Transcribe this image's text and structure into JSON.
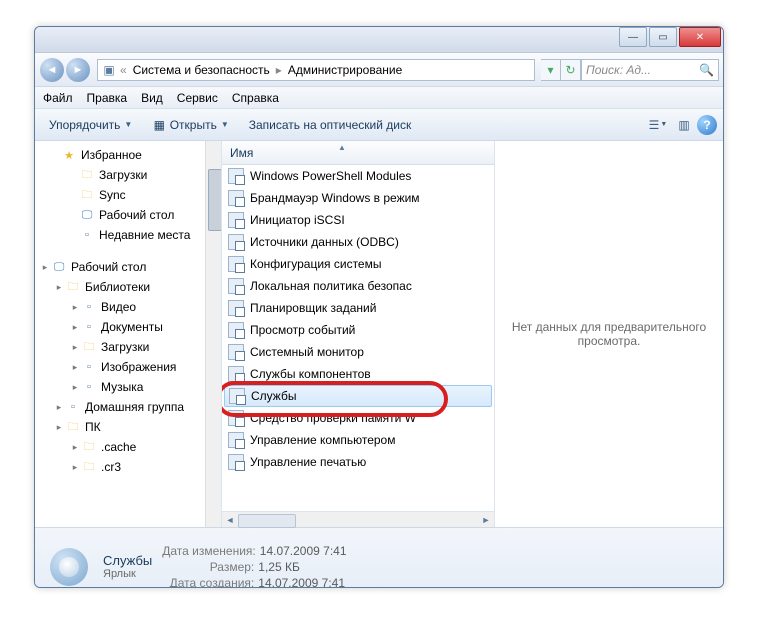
{
  "title": {
    "minimize": "—",
    "maximize": "▭",
    "close": "✕"
  },
  "breadcrumbs": {
    "pre": "«",
    "a": "Система и безопасность",
    "b": "Администрирование"
  },
  "search": {
    "placeholder": "Поиск: Ад..."
  },
  "menubar": {
    "file": "Файл",
    "edit": "Правка",
    "view": "Вид",
    "tools": "Сервис",
    "help": "Справка"
  },
  "toolbar": {
    "organize": "Упорядочить",
    "open": "Открыть",
    "burn": "Записать на оптический диск"
  },
  "treeview": [
    {
      "indent": 14,
      "arrow": "",
      "icon": "star",
      "label": "Избранное"
    },
    {
      "indent": 32,
      "arrow": "",
      "icon": "fld",
      "label": "Загрузки"
    },
    {
      "indent": 32,
      "arrow": "",
      "icon": "fld",
      "label": "Sync"
    },
    {
      "indent": 32,
      "arrow": "",
      "icon": "dsk",
      "label": "Рабочий стол"
    },
    {
      "indent": 32,
      "arrow": "",
      "icon": "generic",
      "label": "Недавние места"
    },
    {
      "spacer": true
    },
    {
      "indent": 4,
      "arrow": "▸",
      "icon": "dsk",
      "label": "Рабочий стол"
    },
    {
      "indent": 18,
      "arrow": "▸",
      "icon": "fld",
      "label": "Библиотеки"
    },
    {
      "indent": 34,
      "arrow": "▸",
      "icon": "generic",
      "label": "Видео"
    },
    {
      "indent": 34,
      "arrow": "▸",
      "icon": "generic",
      "label": "Документы"
    },
    {
      "indent": 34,
      "arrow": "▸",
      "icon": "fld",
      "label": "Загрузки"
    },
    {
      "indent": 34,
      "arrow": "▸",
      "icon": "generic",
      "label": "Изображения"
    },
    {
      "indent": 34,
      "arrow": "▸",
      "icon": "generic",
      "label": "Музыка"
    },
    {
      "indent": 18,
      "arrow": "▸",
      "icon": "generic",
      "label": "Домашняя группа"
    },
    {
      "indent": 18,
      "arrow": "▸",
      "icon": "fld",
      "label": "ПК"
    },
    {
      "indent": 34,
      "arrow": "▸",
      "icon": "fld",
      "label": ".cache"
    },
    {
      "indent": 34,
      "arrow": "▸",
      "icon": "fld",
      "label": ".cr3"
    }
  ],
  "column": {
    "name": "Имя"
  },
  "files": [
    {
      "label": "Windows PowerShell Modules"
    },
    {
      "label": "Брандмауэр Windows в режим"
    },
    {
      "label": "Инициатор iSCSI"
    },
    {
      "label": "Источники данных (ODBC)"
    },
    {
      "label": "Конфигурация системы"
    },
    {
      "label": "Локальная политика безопас"
    },
    {
      "label": "Планировщик заданий"
    },
    {
      "label": "Просмотр событий"
    },
    {
      "label": "Системный монитор"
    },
    {
      "label": "Службы компонентов"
    },
    {
      "label": "Службы",
      "selected": true
    },
    {
      "label": "Средство проверки памяти W"
    },
    {
      "label": "Управление компьютером"
    },
    {
      "label": "Управление печатью"
    }
  ],
  "preview": {
    "empty": "Нет данных для предварительного просмотра."
  },
  "details": {
    "name": "Службы",
    "type": "Ярлык",
    "l_modified": "Дата изменения:",
    "v_modified": "14.07.2009 7:41",
    "l_size": "Размер:",
    "v_size": "1,25 КБ",
    "l_created": "Дата создания:",
    "v_created": "14.07.2009 7:41"
  }
}
